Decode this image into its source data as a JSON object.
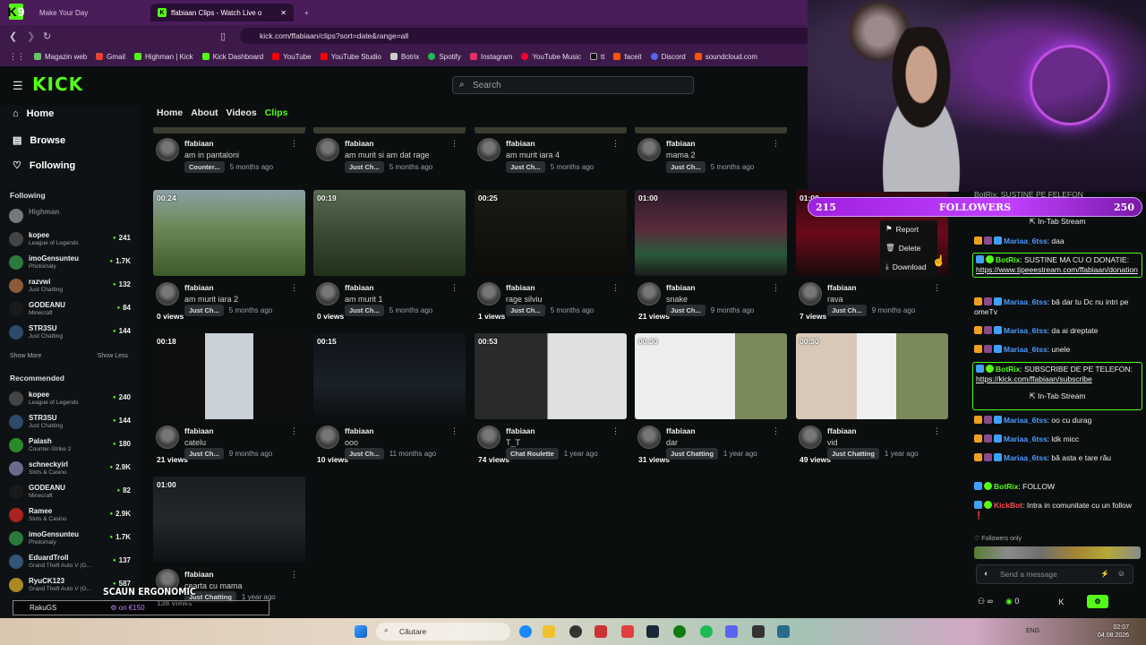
{
  "browser": {
    "tabs": [
      {
        "label": "Make Your Day",
        "active": false
      },
      {
        "label": "ffabiaan Clips - Watch Live o",
        "active": true
      }
    ],
    "new_tab": "+",
    "tab_close": "✕",
    "logo_letter": "K",
    "logo_digit": "9",
    "url": "kick.com/ffabiaan/clips?sort=date&range=all",
    "bookmarks": [
      {
        "label": "Magazin web",
        "color": "#6ac36a"
      },
      {
        "label": "Gmail",
        "color": "#ea4335"
      },
      {
        "label": "Highman | Kick",
        "color": "#53fc18"
      },
      {
        "label": "Kick Dashboard",
        "color": "#53fc18"
      },
      {
        "label": "YouTube",
        "color": "#ff0000"
      },
      {
        "label": "YouTube Studio",
        "color": "#ff0000"
      },
      {
        "label": "Botrix",
        "color": "#cccccc"
      },
      {
        "label": "Spotify",
        "color": "#1db954"
      },
      {
        "label": "Instagram",
        "color": "#e1306c"
      },
      {
        "label": "YouTube Music",
        "color": "#ff0033"
      },
      {
        "label": "tt",
        "color": "#111111"
      },
      {
        "label": "faceit",
        "color": "#ff5500"
      },
      {
        "label": "Discord",
        "color": "#5865f2"
      },
      {
        "label": "soundcloud.com",
        "color": "#ff5500"
      }
    ]
  },
  "kick": {
    "logo": "KICK",
    "search_placeholder": "Search",
    "nav": [
      {
        "label": "Home"
      },
      {
        "label": "Browse"
      },
      {
        "label": "Following"
      }
    ],
    "following_header": "Following",
    "following": [
      {
        "name": "Highman",
        "game": "",
        "viewers": "",
        "color": "#777777"
      },
      {
        "name": "kopee",
        "game": "League of Legends",
        "viewers": "241",
        "color": "#444444"
      },
      {
        "name": "imoGensuntеu",
        "game": "Photomaly",
        "viewers": "1.7K",
        "color": "#2b7a3b"
      },
      {
        "name": "razvwi",
        "game": "Just Chatting",
        "viewers": "132",
        "color": "#8a5a3a"
      },
      {
        "name": "GODEANU",
        "game": "Minecraft",
        "viewers": "84",
        "color": "#1a1a1a"
      },
      {
        "name": "STR3SU",
        "game": "Just Chatting",
        "viewers": "144",
        "color": "#2d4a6a"
      }
    ],
    "show_more": "Show More",
    "show_less": "Show Less",
    "recommended_header": "Recommended",
    "recommended": [
      {
        "name": "kopee",
        "game": "League of Legends",
        "viewers": "240",
        "color": "#444444"
      },
      {
        "name": "STR3SU",
        "game": "Just Chatting",
        "viewers": "144",
        "color": "#2d4a6a"
      },
      {
        "name": "Palash",
        "game": "Counter-Strike 2",
        "viewers": "180",
        "color": "#2a8a2a"
      },
      {
        "name": "schneckyirl",
        "game": "Slots & Casino",
        "viewers": "2.9K",
        "color": "#6a6a8a"
      },
      {
        "name": "GODEANU",
        "game": "Minecraft",
        "viewers": "82",
        "color": "#1a1a1a"
      },
      {
        "name": "Ramee",
        "game": "Slots & Casino",
        "viewers": "2.9K",
        "color": "#aa2222"
      },
      {
        "name": "imoGensuntеu",
        "game": "Photomaly",
        "viewers": "1.7K",
        "color": "#2b7a3b"
      },
      {
        "name": "EduardTroll",
        "game": "Grand Theft Auto V (G...",
        "viewers": "137",
        "color": "#335577"
      },
      {
        "name": "RyuCK123",
        "game": "Grand Theft Auto V (G...",
        "viewers": "587",
        "color": "#aa8822"
      }
    ],
    "tabs": [
      {
        "label": "Home"
      },
      {
        "label": "About"
      },
      {
        "label": "Videos"
      },
      {
        "label": "Clips"
      }
    ],
    "clips_top_row": [
      {
        "user": "ffabiaan",
        "title": "am in pantaloni",
        "category": "Counter...",
        "age": "5 months ago"
      },
      {
        "user": "ffabiaan",
        "title": "am murit si am dat rage",
        "category": "Just Ch...",
        "age": "5 months ago"
      },
      {
        "user": "ffabiaan",
        "title": "am murit iara 4",
        "category": "Just Ch...",
        "age": "5 months ago"
      },
      {
        "user": "ffabiaan",
        "title": "mama 2",
        "category": "Just Ch...",
        "age": "5 months ago"
      }
    ],
    "clips": [
      {
        "duration": "00:24",
        "views": "0 views",
        "user": "ffabiaan",
        "title": "am murit iara 2",
        "category": "Just Ch...",
        "age": "5 months ago",
        "bg": "linear-gradient(180deg,#8aa0a8 0%,#6f8a5a 40%,#3f5a2a 100%)"
      },
      {
        "duration": "00:19",
        "views": "0 views",
        "user": "ffabiaan",
        "title": "am murit 1",
        "category": "Just Ch...",
        "age": "5 months ago",
        "bg": "linear-gradient(180deg,#5a6a52 0%,#3a4a32 50%,#22301c 100%)"
      },
      {
        "duration": "00:25",
        "views": "1 views",
        "user": "ffabiaan",
        "title": "rage silviu",
        "category": "Just Ch...",
        "age": "5 months ago",
        "bg": "linear-gradient(180deg,#1a1a14 0%,#0e0c08 100%)"
      },
      {
        "duration": "01:00",
        "views": "21 views",
        "user": "ffabiaan",
        "title": "snake",
        "category": "Just Ch...",
        "age": "9 months ago",
        "bg": "linear-gradient(180deg,#2a1a2a 0%,#5a2a3a 45%,#2a5a3a 75%,#1a1a1a 100%)"
      },
      {
        "duration": "01:00",
        "views": "7 views",
        "user": "ffabiaan",
        "title": "rava",
        "category": "Just Ch...",
        "age": "9 months ago",
        "bg": "linear-gradient(180deg,#2a0a10 0%,#6a0a1a 50%,#1a0a0a 100%)"
      },
      {
        "duration": "00:18",
        "views": "21 views",
        "user": "ffabiaan",
        "title": "catelu",
        "category": "Just Ch...",
        "age": "9 months ago",
        "bg": "linear-gradient(90deg,#0e0e0e 0 34%,#c8d0d8 34% 66%,#0e0e0e 66%)"
      },
      {
        "duration": "00:15",
        "views": "10 views",
        "user": "ffabiaan",
        "title": "ooo",
        "category": "Just Ch...",
        "age": "11 months ago",
        "bg": "linear-gradient(180deg,#101418 0%,#1a2028 60%,#0c0e10 100%)"
      },
      {
        "duration": "00:53",
        "views": "74 views",
        "user": "ffabiaan",
        "title": "T_T",
        "category": "Chat Roulette",
        "age": "1 year ago",
        "bg": "linear-gradient(90deg,#2a2a2a 0 48%,#e0e0e0 48%)"
      },
      {
        "duration": "00:30",
        "views": "31 views",
        "user": "ffabiaan",
        "title": "dar",
        "category": "Just Chatting",
        "age": "1 year ago",
        "bg": "linear-gradient(90deg,#eeeeee 0 66%,#7a8a5a 66%)"
      },
      {
        "duration": "00:30",
        "views": "49 views",
        "user": "ffabiaan",
        "title": "vid",
        "category": "Just Chatting",
        "age": "1 year ago",
        "bg": "linear-gradient(90deg,#d8c8b8 0 40%,#f0f0f0 40% 66%,#7a8a5a 66%)"
      },
      {
        "duration": "01:00",
        "views": "138 views",
        "user": "ffabiaan",
        "title": "cearta cu mama",
        "category": "Just Chatting",
        "age": "1 year ago",
        "bg": "linear-gradient(180deg,#1a1e22 0%,#22282c 50%,#101214 100%)"
      }
    ],
    "context_menu": [
      {
        "label": "Report",
        "icon": "flag-icon"
      },
      {
        "label": "Delete",
        "icon": "trash-icon"
      },
      {
        "label": "Download",
        "icon": "download-icon"
      }
    ]
  },
  "overlay": {
    "followers_left": "215",
    "followers_label": "FOLLOWERS",
    "followers_right": "250",
    "ergo_text": "SCAUN ERGONOMIC",
    "raku_name": "RakuGS",
    "raku_price": "on €150"
  },
  "chat": {
    "top_partial": "BotRix: SUSTINE PE FELEFON",
    "in_tab_1": "In-Tab Stream",
    "messages": [
      {
        "user": "Mariaa_6tss",
        "text": "daa",
        "color": "#4b9bff"
      },
      {
        "user": "BotRix",
        "text": "SUSTINE MA CU O DONATIE: ",
        "link": "https://www.tipeeestream.com/ffabiaan/donation",
        "color": "#53fc18"
      },
      {
        "user": "Mariaa_6tss",
        "text": "bă dar tu Dc nu intri pe omeTv",
        "color": "#4b9bff"
      },
      {
        "user": "Mariaa_6tss",
        "text": "da ai dreptate",
        "color": "#4b9bff"
      },
      {
        "user": "Mariaa_6tss",
        "text": "unele",
        "color": "#4b9bff"
      },
      {
        "user": "BotRix",
        "text": "SUBSCRIBE DE PE TELEFON: ",
        "link": "https://kick.com/ffabiaan/subscribe",
        "color": "#53fc18"
      },
      {
        "user": "Mariaa_6tss",
        "text": "oo cu durag",
        "color": "#4b9bff"
      },
      {
        "user": "Mariaa_6tss",
        "text": "ldk micc",
        "color": "#4b9bff"
      },
      {
        "user": "Mariaa_6tss",
        "text": "bă asta e tare rău",
        "color": "#4b9bff"
      },
      {
        "user": "BotRix",
        "text": "FOLLOW",
        "color": "#53fc18"
      },
      {
        "user": "KickBot",
        "text": "Intra in comunitate cu un follow ❗",
        "color": "#ff4b4b"
      }
    ],
    "in_tab_2": "In-Tab Stream",
    "followers_only": "Followers only",
    "input_placeholder": "Send a message",
    "infinity_label": "∞",
    "zero_label": "0",
    "k_label": "K"
  },
  "taskbar": {
    "search": "Căutare",
    "lang": "ENG",
    "time": "02:07",
    "date": "04.08.2026"
  }
}
